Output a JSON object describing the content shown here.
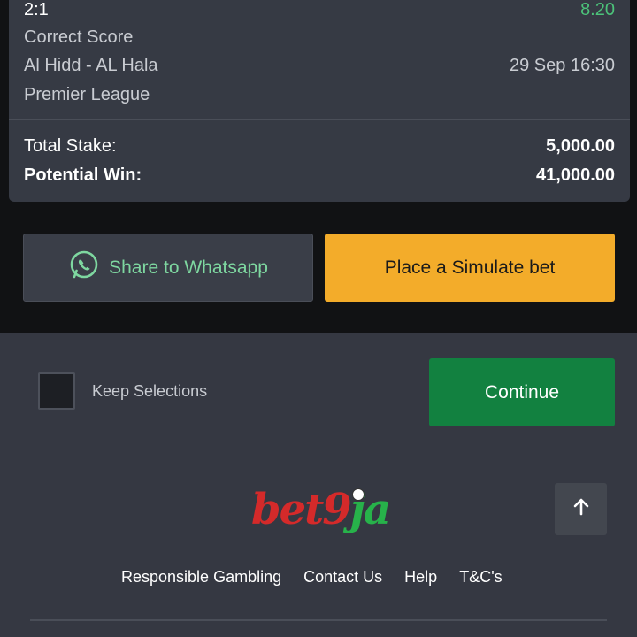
{
  "bet": {
    "score": "2:1",
    "odds": "8.20",
    "market": "Correct Score",
    "event": "Al Hidd - AL Hala",
    "datetime": "29 Sep 16:30",
    "league": "Premier League",
    "total_stake_label": "Total Stake:",
    "total_stake_value": "5,000.00",
    "potential_win_label": "Potential Win:",
    "potential_win_value": "41,000.00"
  },
  "actions": {
    "share_label": "Share to Whatsapp",
    "place_label": "Place a Simulate bet"
  },
  "panel": {
    "keep_label": "Keep Selections",
    "continue_label": "Continue"
  },
  "logo": {
    "text_bet": "bet",
    "text_nine": "9",
    "text_ja": "ja"
  },
  "footer": {
    "links": [
      "Responsible Gambling",
      "Contact Us",
      "Help",
      "T&C's"
    ]
  },
  "icons": {
    "whatsapp": "whatsapp-icon",
    "scroll_top": "arrow-up-icon"
  },
  "colors": {
    "odds": "#4cc37a",
    "share_text": "#7ed7a0",
    "place_bg": "#f3ac2a",
    "continue_bg": "#128140",
    "logo_red": "#d42a2a",
    "logo_green": "#27b24a"
  }
}
